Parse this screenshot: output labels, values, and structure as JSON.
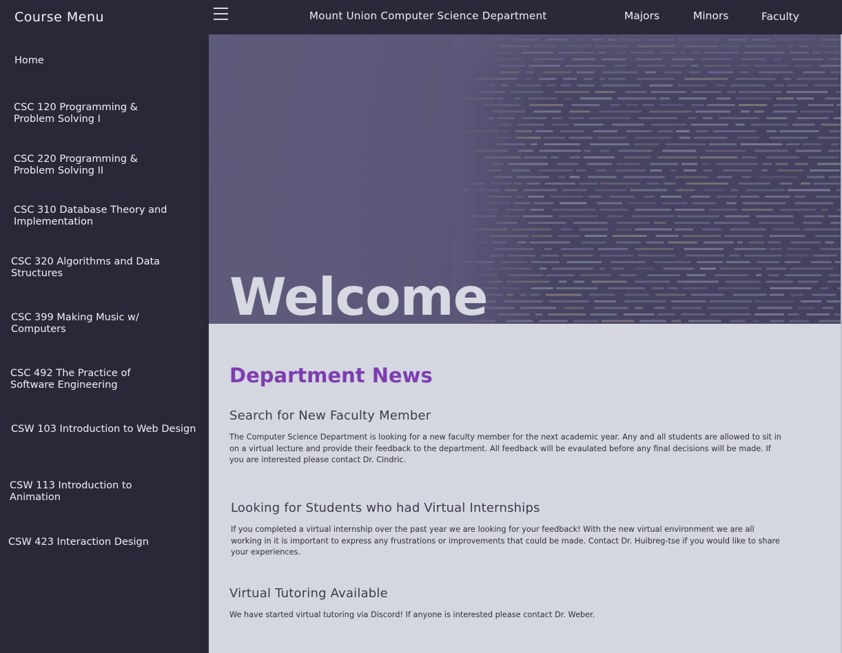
{
  "sidebar": {
    "title": "Course Menu",
    "items": [
      {
        "label": "Home"
      },
      {
        "label": "CSC 120 Programming & Problem Solving I"
      },
      {
        "label": "CSC 220 Programming & Problem Solving II"
      },
      {
        "label": "CSC 310 Database Theory and Implementation"
      },
      {
        "label": "CSC 320 Algorithms and Data Structures"
      },
      {
        "label": "CSC 399 Making Music w/ Computers"
      },
      {
        "label": "CSC 492 The Practice of Software Engineering"
      },
      {
        "label": "CSW 103 Introduction to Web Design"
      },
      {
        "label": "CSW 113 Introduction to Animation"
      },
      {
        "label": "CSW 423 Interaction Design"
      }
    ]
  },
  "header": {
    "menu_icon": "hamburger-icon",
    "title": "Mount Union Computer Science Department",
    "nav": [
      {
        "label": "Majors"
      },
      {
        "label": "Minors"
      },
      {
        "label": "Faculty"
      }
    ]
  },
  "hero": {
    "title": "Welcome"
  },
  "news": {
    "heading": "Department News",
    "items": [
      {
        "title": "Search for New Faculty Member",
        "body": "The Computer Science Department is looking for a new faculty member for the next academic year. Any and all students are allowed to sit in on a virtual lecture and provide their feedback to the department. All feedback will be evaulated before any final decisions will be made. If you are interested please contact Dr. Cindric."
      },
      {
        "title": "Looking for Students who had Virtual Internships",
        "body": "If you completed a virtual internship over the past year we are looking for your feedback! With the new virtual environment we are all working in it is important to express any frustrations or improvements that could be made. Contact Dr. Huibreg-tse if you would like to share your experiences."
      },
      {
        "title": "Virtual Tutoring Available",
        "body": "We have started virtual tutoring via Discord! If anyone is interested please contact Dr. Weber."
      }
    ]
  },
  "colors": {
    "sidebar_bg": "#2a2838",
    "accent": "#7d3db0",
    "content_bg": "#d4d7e0"
  }
}
